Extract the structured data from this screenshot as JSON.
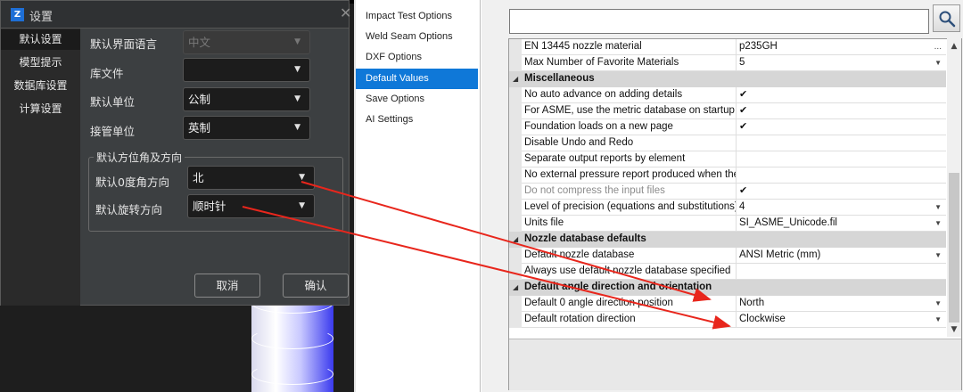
{
  "dialog": {
    "title": "设置",
    "nav": [
      "默认设置",
      "模型提示",
      "数据库设置",
      "计算设置"
    ],
    "fields": {
      "ui_language": {
        "label": "默认界面语言",
        "value": "中文"
      },
      "library_file": {
        "label": "库文件",
        "value": ""
      },
      "default_unit": {
        "label": "默认单位",
        "value": "公制"
      },
      "nozzle_unit": {
        "label": "接管单位",
        "value": "英制"
      }
    },
    "group": {
      "title": "默认方位角及方向",
      "zero_angle": {
        "label": "默认0度角方向",
        "value": "北"
      },
      "rotation": {
        "label": "默认旋转方向",
        "value": "顺时针"
      }
    },
    "buttons": {
      "cancel": "取消",
      "ok": "确认"
    }
  },
  "options": [
    "Impact Test Options",
    "Weld Seam Options",
    "DXF Options",
    "Default Values",
    "Save Options",
    "AI Settings"
  ],
  "selected_option": "Default Values",
  "accent": "#0f78d8",
  "search": {
    "value": ""
  },
  "grid": {
    "rows": [
      {
        "name": "EN 13445 nozzle material",
        "value": "p235GH",
        "more": "..."
      },
      {
        "name": "Max Number of Favorite Materials",
        "value": "5"
      },
      {
        "category": "Miscellaneous"
      },
      {
        "name": "No auto advance on adding details",
        "value": "✔"
      },
      {
        "name": "For ASME, use the metric database on startup",
        "value": "✔"
      },
      {
        "name": "Foundation loads on a new page",
        "value": "✔"
      },
      {
        "name": "Disable Undo and Redo",
        "value": ""
      },
      {
        "name": "Separate output reports by element",
        "value": ""
      },
      {
        "name": "No external pressure report produced when ther",
        "value": ""
      },
      {
        "name": "Do not compress the input files",
        "value": "✔"
      },
      {
        "name": "Level of precision (equations and substitutions)",
        "value": "4"
      },
      {
        "name": "Units file",
        "value": "SI_ASME_Unicode.fil"
      },
      {
        "category": "Nozzle database defaults"
      },
      {
        "name": "Default nozzle database",
        "value": "ANSI Metric (mm)"
      },
      {
        "name": "Always use default nozzle database specified",
        "value": ""
      },
      {
        "category": "Default angle direction and orientation"
      },
      {
        "name": "Default 0 angle direction position",
        "value": "North"
      },
      {
        "name": "Default rotation direction",
        "value": "Clockwise"
      }
    ]
  }
}
